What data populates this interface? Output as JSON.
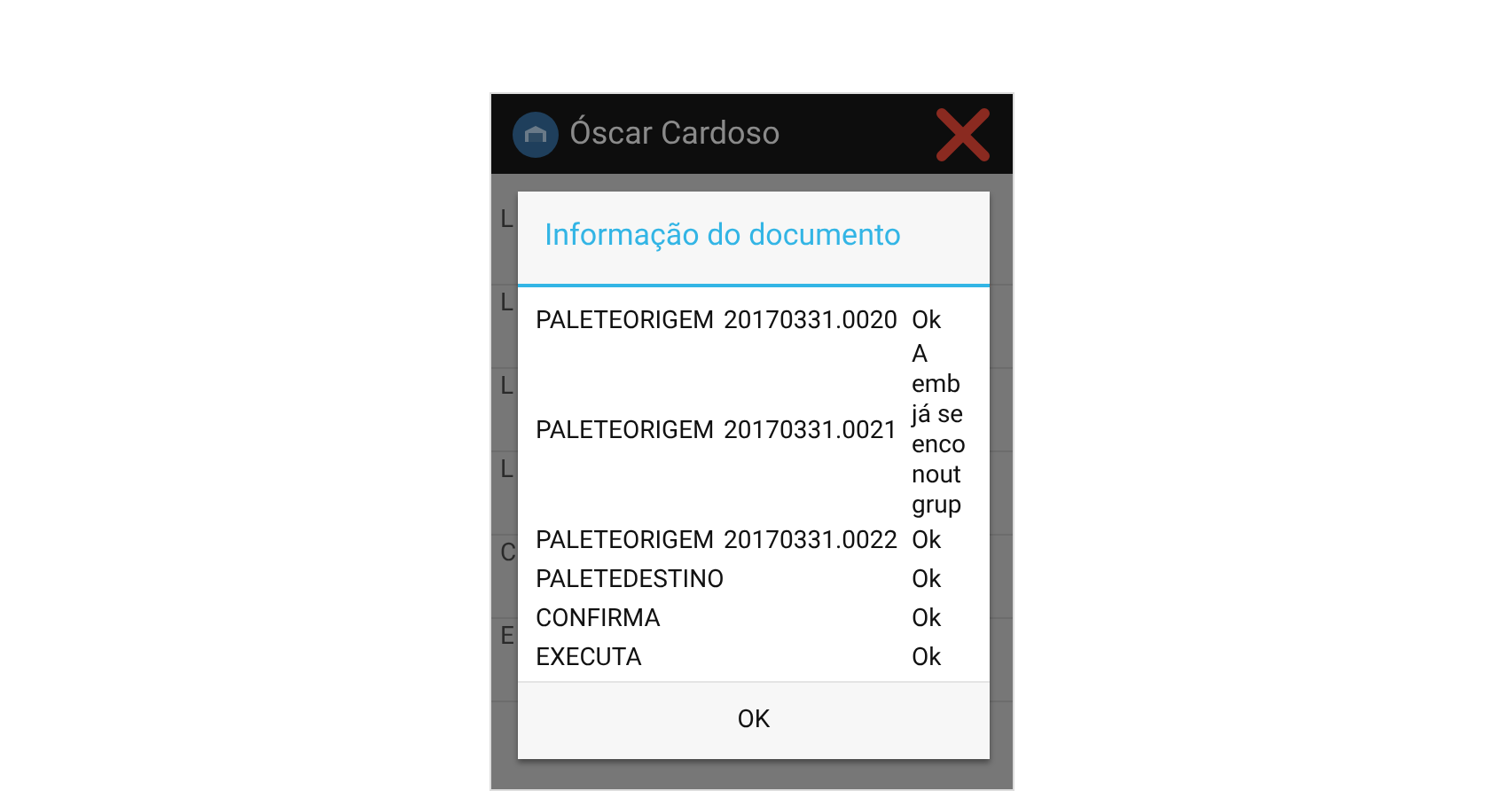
{
  "app_bar": {
    "title": "Óscar Cardoso"
  },
  "background_list": [
    "L",
    "L",
    "L",
    "L",
    "C",
    "E"
  ],
  "dialog": {
    "title": "Informação do documento",
    "rows": [
      {
        "column_1": "PALETEORIGEM",
        "column_2": "20170331.0020",
        "column_3": [
          "Ok"
        ]
      },
      {
        "column_1": "PALETEORIGEM",
        "column_2": "20170331.0021",
        "column_3": [
          "A",
          "emb",
          "já se",
          "enco",
          "nout",
          "grup"
        ]
      },
      {
        "column_1": "PALETEORIGEM",
        "column_2": "20170331.0022",
        "column_3": [
          "Ok"
        ]
      },
      {
        "column_1": "PALETEDESTINO",
        "column_3": [
          "Ok"
        ]
      },
      {
        "column_1": "CONFIRMA",
        "column_3": [
          "Ok"
        ]
      },
      {
        "column_1": "EXECUTA",
        "column_3": [
          "Ok"
        ]
      }
    ],
    "button": "OK"
  }
}
